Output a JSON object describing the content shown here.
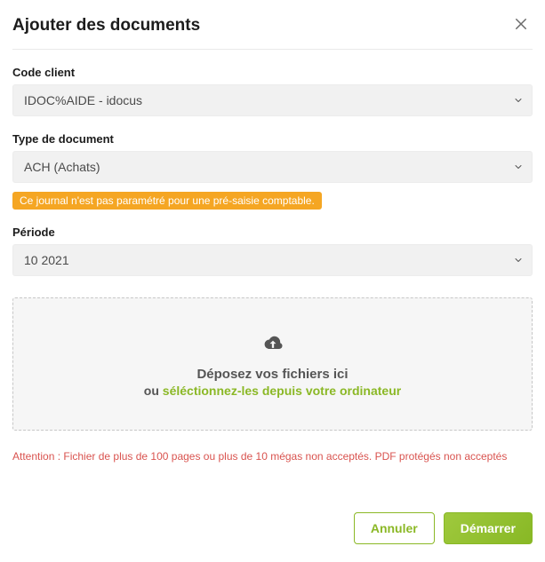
{
  "modal": {
    "title": "Ajouter des documents"
  },
  "fields": {
    "client": {
      "label": "Code client",
      "value": "IDOC%AIDE - idocus"
    },
    "doctype": {
      "label": "Type de document",
      "value": "ACH (Achats)",
      "badge": "Ce journal n'est pas paramétré pour une pré-saisie comptable."
    },
    "period": {
      "label": "Période",
      "value": "10 2021"
    }
  },
  "drop": {
    "title": "Déposez vos fichiers ici",
    "or": "ou",
    "link": "séléctionnez-les depuis votre ordinateur"
  },
  "warning": "Attention : Fichier de plus de 100 pages ou plus de 10 mégas non acceptés. PDF protégés non acceptés",
  "buttons": {
    "cancel": "Annuler",
    "start": "Démarrer"
  }
}
